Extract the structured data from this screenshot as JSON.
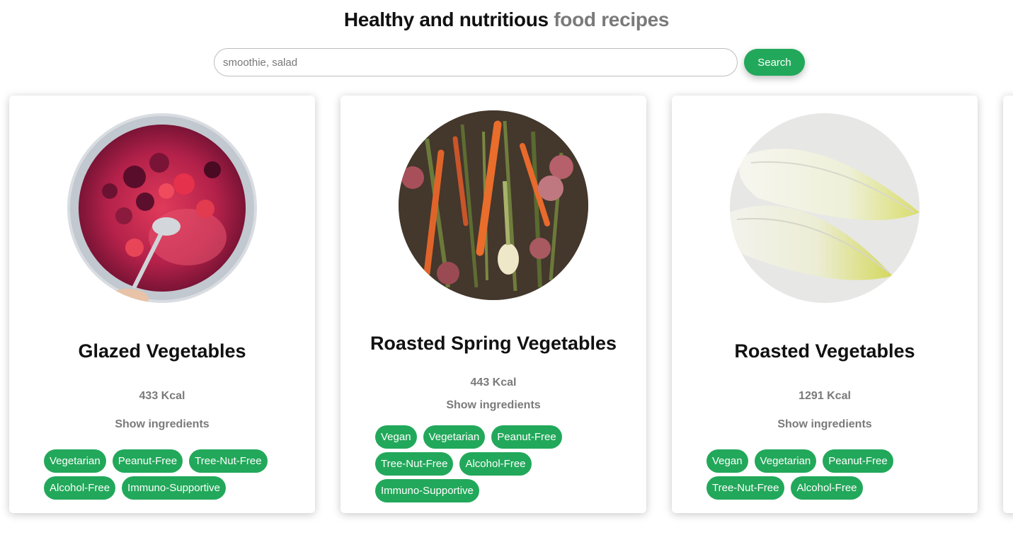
{
  "header": {
    "title_main": "Healthy and nutritious",
    "title_accent": "food recipes"
  },
  "search": {
    "placeholder": "smoothie, salad",
    "button_label": "Search"
  },
  "colors": {
    "accent_green": "#22a85a",
    "muted_text": "#7a7a7a"
  },
  "recipes": [
    {
      "title": "Glazed Vegetables",
      "kcal": "433 Kcal",
      "show_ingredients": "Show ingredients",
      "tags": [
        "Vegetarian",
        "Peanut-Free",
        "Tree-Nut-Free",
        "Alcohol-Free",
        "Immuno-Supportive"
      ]
    },
    {
      "title": "Roasted Spring Vegetables",
      "kcal": "443 Kcal",
      "show_ingredients": "Show ingredients",
      "tags": [
        "Vegan",
        "Vegetarian",
        "Peanut-Free",
        "Tree-Nut-Free",
        "Alcohol-Free",
        "Immuno-Supportive"
      ]
    },
    {
      "title": "Roasted Vegetables",
      "kcal": "1291 Kcal",
      "show_ingredients": "Show ingredients",
      "tags": [
        "Vegan",
        "Vegetarian",
        "Peanut-Free",
        "Tree-Nut-Free",
        "Alcohol-Free"
      ]
    }
  ]
}
